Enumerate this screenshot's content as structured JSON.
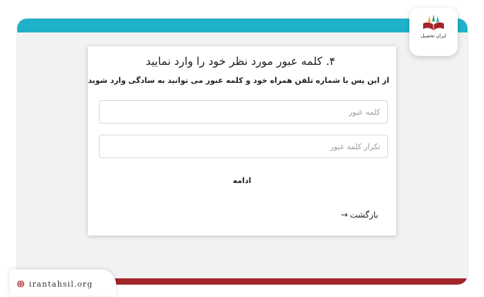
{
  "brand": {
    "name": "ایران تحصیل",
    "url": "irantahsil.org"
  },
  "icons": {
    "logo": "book-pencil-logo-icon",
    "globe": "globe-icon",
    "back_arrow": "arrow-right-icon"
  },
  "form": {
    "title": "۴. کلمه عبور مورد نظر خود را وارد نمایید",
    "subtitle": "از این پس با شماره تلفن همراه خود و کلمه عبور می توانید به سادگی وارد شوید",
    "password_placeholder": "کلمه عبور",
    "confirm_placeholder": "تکرار کلمه عبور",
    "continue_label": "ادامه",
    "back_label": "بازگشت",
    "back_arrow": "→"
  },
  "colors": {
    "top_band": "#1fb1c9",
    "bottom_band": "#a3232b",
    "background": "#f2f2f2"
  }
}
